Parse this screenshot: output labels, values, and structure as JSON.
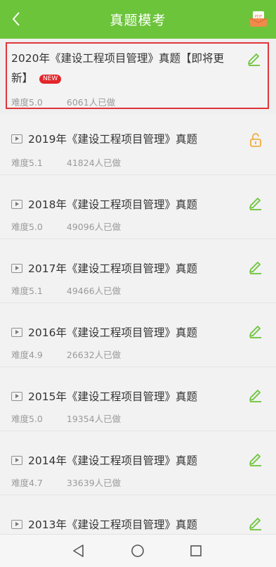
{
  "header": {
    "title": "真题模考",
    "back_icon": "chevron-left-icon",
    "pdf_icon": "pdf-icon",
    "pdf_label": "PDF"
  },
  "colors": {
    "brand": "#6cc43a",
    "highlight_border": "#e0353b",
    "badge": "#e3262b",
    "unlock": "#f0a52b"
  },
  "featured": {
    "title": "2020年《建设工程项目管理》真题【即将更新】",
    "badge": "NEW",
    "difficulty": "难度5.0",
    "count": "6061人已做",
    "action_icon": "pencil-icon"
  },
  "items": [
    {
      "title": "2019年《建设工程项目管理》真题",
      "difficulty": "难度5.1",
      "count": "41824人已做",
      "action_icon": "unlock-icon"
    },
    {
      "title": "2018年《建设工程项目管理》真题",
      "difficulty": "难度5.0",
      "count": "49096人已做",
      "action_icon": "pencil-icon"
    },
    {
      "title": "2017年《建设工程项目管理》真题",
      "difficulty": "难度5.1",
      "count": "49466人已做",
      "action_icon": "pencil-icon"
    },
    {
      "title": "2016年《建设工程项目管理》真题",
      "difficulty": "难度4.9",
      "count": "26632人已做",
      "action_icon": "pencil-icon"
    },
    {
      "title": "2015年《建设工程项目管理》真题",
      "difficulty": "难度5.0",
      "count": "19354人已做",
      "action_icon": "pencil-icon"
    },
    {
      "title": "2014年《建设工程项目管理》真题",
      "difficulty": "难度4.7",
      "count": "33639人已做",
      "action_icon": "pencil-icon"
    },
    {
      "title": "2013年《建设工程项目管理》真题",
      "difficulty": "",
      "count": "",
      "action_icon": "pencil-icon"
    }
  ],
  "navbar": {
    "back_icon": "triangle-back-icon",
    "home_icon": "circle-home-icon",
    "recents_icon": "square-recents-icon"
  }
}
